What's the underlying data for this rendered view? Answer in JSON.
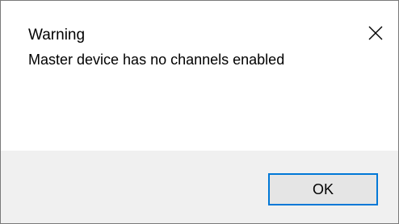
{
  "dialog": {
    "title": "Warning",
    "message": "Master device has no channels enabled",
    "ok_label": "OK",
    "accent_color": "#0078d7",
    "footer_color": "#f0f0f0"
  },
  "icons": {
    "close": "close-icon"
  }
}
